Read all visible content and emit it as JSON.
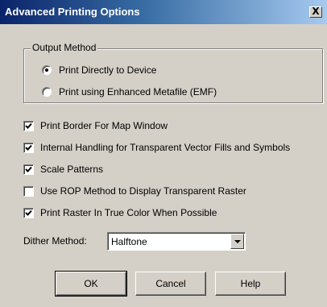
{
  "window": {
    "title": "Advanced Printing Options",
    "close_label": "X"
  },
  "output_method": {
    "label": "Output Method",
    "options": [
      {
        "label": "Print Directly to Device",
        "selected": true
      },
      {
        "label": "Print using Enhanced Metafile (EMF)",
        "selected": false
      }
    ]
  },
  "checkboxes": [
    {
      "label": "Print Border For Map Window",
      "checked": true
    },
    {
      "label": "Internal Handling for Transparent Vector Fills and Symbols",
      "checked": true
    },
    {
      "label": "Scale Patterns",
      "checked": true
    },
    {
      "label": "Use ROP Method to Display Transparent Raster",
      "checked": false
    },
    {
      "label": "Print Raster In True Color When Possible",
      "checked": true
    }
  ],
  "dither": {
    "label": "Dither Method:",
    "value": "Halftone"
  },
  "buttons": {
    "ok": "OK",
    "cancel": "Cancel",
    "help": "Help"
  }
}
